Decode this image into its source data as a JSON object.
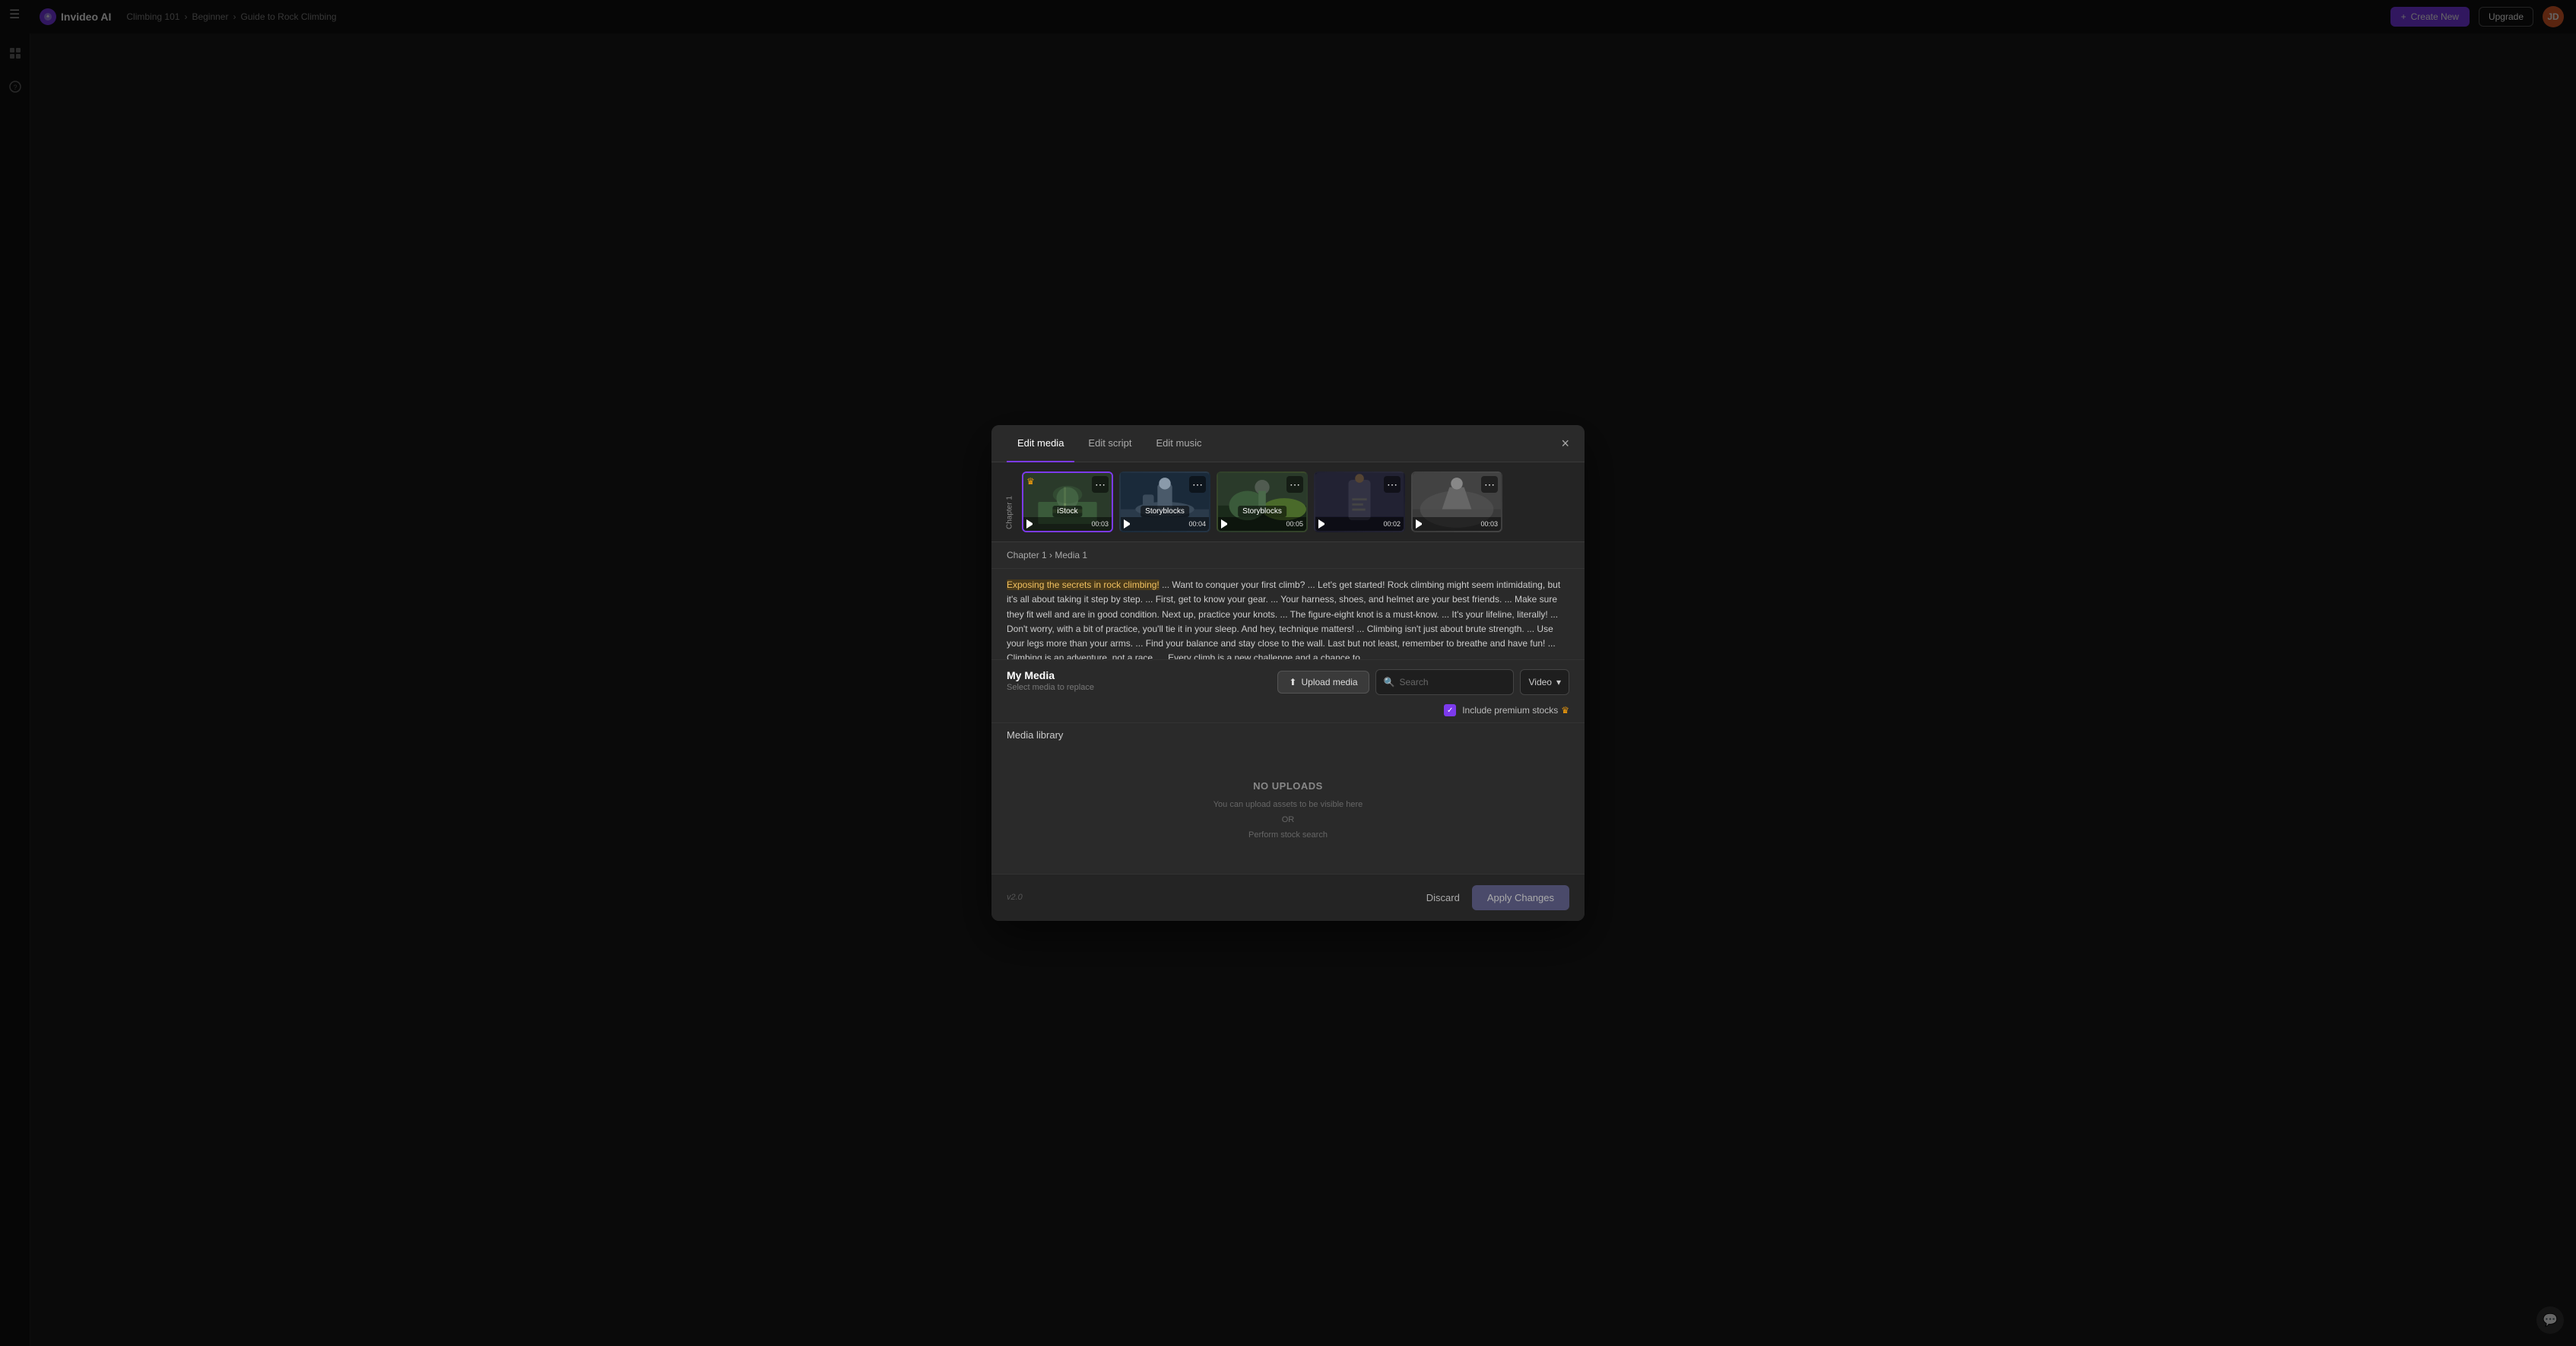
{
  "app": {
    "name": "Invideo AI",
    "logo_initial": "I"
  },
  "topbar": {
    "breadcrumb": [
      "Climbing 101",
      "Beginner",
      "Guide to Rock Climbing"
    ],
    "create_btn": "Create New",
    "upgrade_btn": "Upgrade",
    "avatar_initials": "JD"
  },
  "modal": {
    "tabs": [
      "Edit media",
      "Edit script",
      "Edit music"
    ],
    "active_tab": 0,
    "close_icon": "×",
    "breadcrumb": "Chapter 1 › Media 1",
    "clips": [
      {
        "source": "iStock",
        "duration": "00:03",
        "selected": true,
        "bg": "clip-bg-1"
      },
      {
        "source": "Storyblocks",
        "duration": "00:04",
        "selected": false,
        "bg": "clip-bg-2"
      },
      {
        "source": "Storyblocks",
        "duration": "00:05",
        "selected": false,
        "bg": "clip-bg-3"
      },
      {
        "source": "",
        "duration": "00:02",
        "selected": false,
        "bg": "clip-bg-4"
      },
      {
        "source": "",
        "duration": "00:03",
        "selected": false,
        "bg": "clip-bg-5"
      }
    ],
    "chapter_label": "Chapter 1",
    "script_highlight": "Exposing the secrets in rock climbing!",
    "script_text": " ... Want to conquer your first climb? ... Let's get started! Rock climbing might seem intimidating, but it's all about taking it step by step. ... First, get to know your gear. ... Your harness, shoes, and helmet are your best friends. ... Make sure they fit well and are in good condition. Next up, practice your knots. ... The figure-eight knot is a must-know. ... It's your lifeline, literally! ... Don't worry, with a bit of practice, you'll tie it in your sleep. And hey, technique matters! ... Climbing isn't just about brute strength. ... Use your legs more than your arms. ... Find your balance and stay close to the wall. Last but not least, remember to breathe and have fun! ... Climbing is an adventure, not a race. ... Every climb is a new challenge and a chance to",
    "my_media": {
      "title": "My Media",
      "subtitle": "Select media to replace"
    },
    "upload_btn": "Upload media",
    "search_placeholder": "Search",
    "video_dropdown": "Video",
    "include_premium": "Include premium stocks",
    "media_library_title": "Media library",
    "no_uploads": {
      "title": "NO UPLOADS",
      "line1": "You can upload assets to be visible here",
      "line2": "OR",
      "line3": "Perform stock search"
    },
    "footer": {
      "version": "v2.0",
      "discard": "Discard",
      "apply": "Apply Changes"
    }
  },
  "sidebar": {
    "icons": [
      "grid",
      "help"
    ]
  },
  "chat_icon": "💬"
}
